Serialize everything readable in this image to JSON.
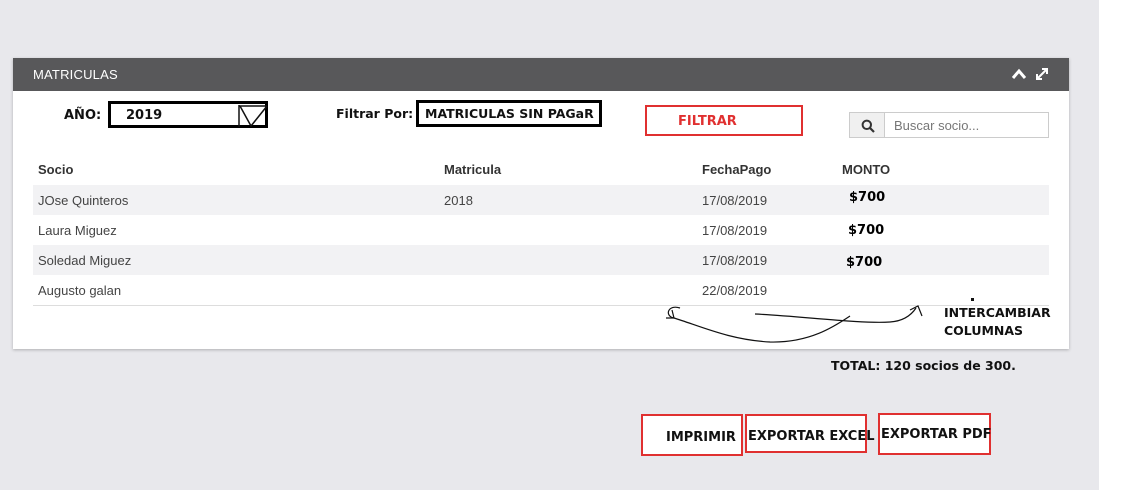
{
  "panel": {
    "title": "MATRICULAS"
  },
  "filters": {
    "year_label": "AÑO:",
    "year_value": "2019",
    "filter_label": "Filtrar Por:",
    "filter_value": "MATRICULAS SIN PAGaR",
    "filter_button": "FILTRAR",
    "search_placeholder": "Buscar socio..."
  },
  "table": {
    "headers": {
      "socio": "Socio",
      "matricula": "Matricula",
      "fecha": "FechaPago",
      "monto": "MONTO"
    },
    "rows": [
      {
        "socio": "JOse Quinteros",
        "matricula": "2018",
        "fecha": "17/08/2019",
        "monto": "$700"
      },
      {
        "socio": "Laura Miguez",
        "matricula": "",
        "fecha": "17/08/2019",
        "monto": "$700"
      },
      {
        "socio": "Soledad Miguez",
        "matricula": "",
        "fecha": "17/08/2019",
        "monto": "$700"
      },
      {
        "socio": "Augusto galan",
        "matricula": "",
        "fecha": "22/08/2019",
        "monto": ""
      }
    ]
  },
  "annotations": {
    "swap_line1": "INTERCAMBIAR",
    "swap_line2": "COLUMNAS",
    "total": "TOTAL: 120 socios de 300."
  },
  "actions": {
    "print": "IMPRIMIR",
    "excel": "EXPORTAR EXCEL",
    "pdf": "EXPORTAR PDF"
  },
  "colors": {
    "header": "#58585a",
    "accent_red": "#e03030",
    "background": "#e8e8ec"
  },
  "icons": [
    "chevron-up-icon",
    "expand-icon",
    "search-icon",
    "dropdown-arrow-icon"
  ]
}
